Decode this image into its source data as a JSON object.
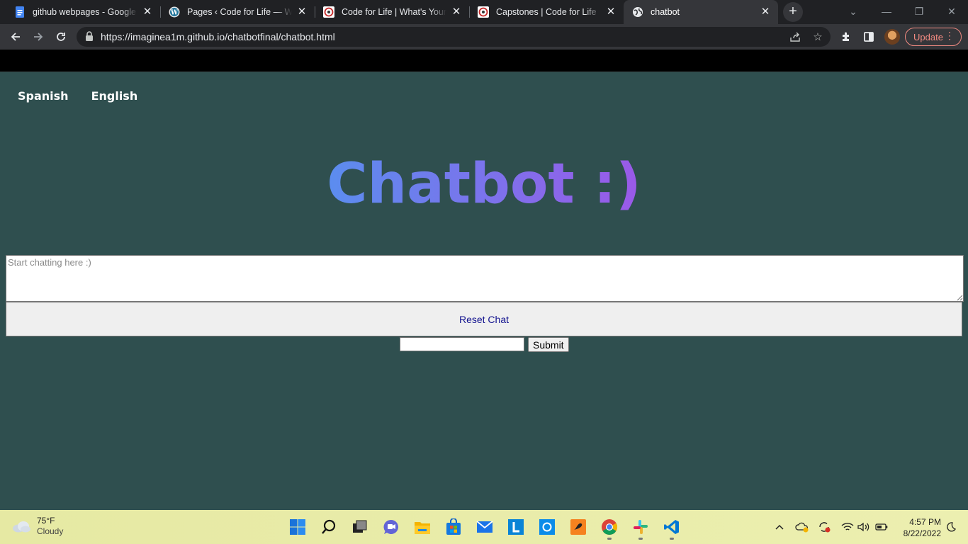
{
  "browser": {
    "tabs": [
      {
        "title": "github webpages - Google D",
        "icon": "google-docs-icon",
        "active": false
      },
      {
        "title": "Pages ‹ Code for Life — Word",
        "icon": "wordpress-icon",
        "active": false
      },
      {
        "title": "Code for Life | What's Your Co",
        "icon": "code-for-life-icon",
        "active": false
      },
      {
        "title": "Capstones | Code for Life",
        "icon": "code-for-life-icon",
        "active": false
      },
      {
        "title": "chatbot",
        "icon": "globe-icon",
        "active": true
      }
    ],
    "url": "https://imaginea1m.github.io/chatbotfinal/chatbot.html",
    "update_label": "Update"
  },
  "page": {
    "nav": [
      {
        "label": "Spanish"
      },
      {
        "label": "English"
      }
    ],
    "heading": "Chatbot :)",
    "chat_placeholder": "Start chatting here :)",
    "reset_label": "Reset Chat",
    "message_value": "",
    "submit_label": "Submit"
  },
  "colors": {
    "page_background": "#2f4f4f",
    "heading_gradient_start": "#5b8def",
    "heading_gradient_end": "#9b59e8",
    "reset_text": "#11118e"
  },
  "taskbar": {
    "weather": {
      "temp": "75°F",
      "condition": "Cloudy"
    },
    "apps": [
      "start-icon",
      "search-icon",
      "task-view-icon",
      "teams-chat-icon",
      "file-explorer-icon",
      "store-icon",
      "mail-icon",
      "l-app-icon",
      "cortana-icon",
      "paint-app-icon",
      "chrome-icon",
      "slack-icon",
      "vscode-icon"
    ],
    "clock": {
      "time": "4:57 PM",
      "date": "8/22/2022"
    }
  }
}
